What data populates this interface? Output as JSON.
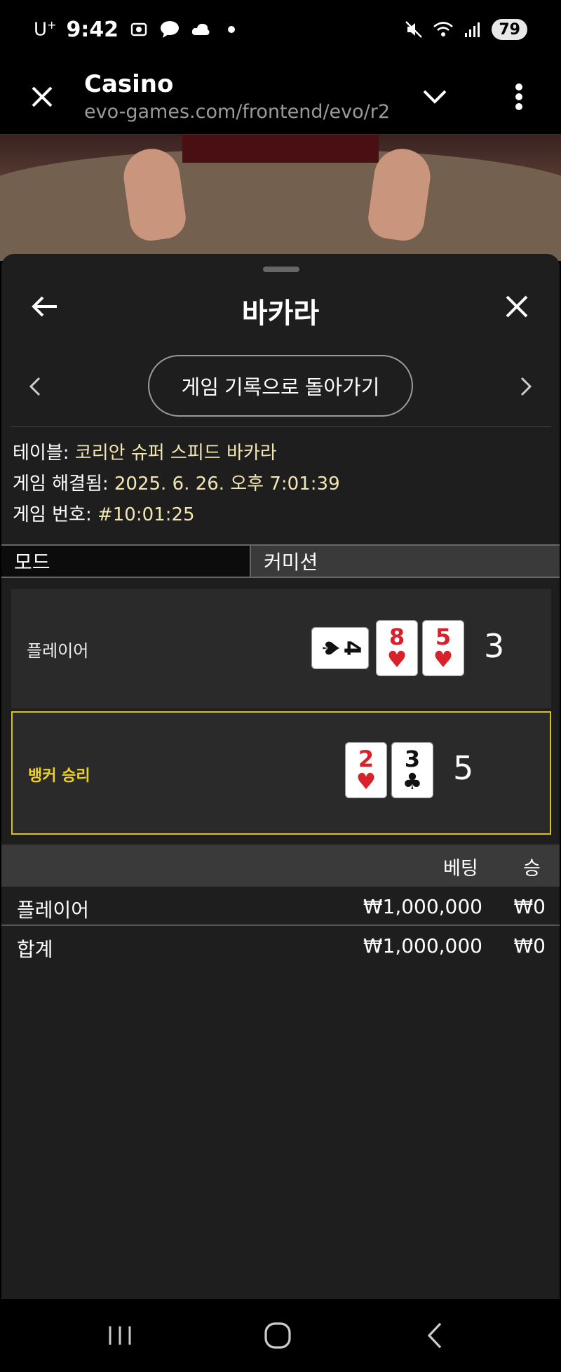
{
  "status_bar": {
    "carrier": "U",
    "carrier_sup": "+",
    "time": "9:42",
    "battery": "79"
  },
  "browser": {
    "title": "Casino",
    "url": "evo-games.com/frontend/evo/r2"
  },
  "panel": {
    "title": "바카라",
    "history_button": "게임 기록으로 돌아가기"
  },
  "info": {
    "table_label": "테이블:",
    "table_value": "코리안 슈퍼 스피드 바카라",
    "resolved_label": "게임 해결됨:",
    "resolved_value": "2025. 6. 26. 오후 7:01:39",
    "number_label": "게임 번호:",
    "number_value": "#10:01:25"
  },
  "tabs": {
    "mode": "모드",
    "commission": "커미션"
  },
  "results": {
    "player": {
      "label": "플레이어",
      "cards": [
        {
          "rank": "4",
          "suit": "♠",
          "color": "black",
          "orientation": "sideways"
        },
        {
          "rank": "8",
          "suit": "♥",
          "color": "red"
        },
        {
          "rank": "5",
          "suit": "♥",
          "color": "red"
        }
      ],
      "score": "3"
    },
    "banker": {
      "label": "뱅커 승리",
      "cards": [
        {
          "rank": "2",
          "suit": "♥",
          "color": "red"
        },
        {
          "rank": "3",
          "suit": "♣",
          "color": "black"
        }
      ],
      "score": "5",
      "highlight_color": "#d9c21b"
    }
  },
  "bets": {
    "header_bet": "베팅",
    "header_win": "승",
    "rows": [
      {
        "name": "플레이어",
        "bet": "₩1,000,000",
        "win": "₩0"
      },
      {
        "name": "합계",
        "bet": "₩1,000,000",
        "win": "₩0"
      }
    ]
  },
  "icons": {
    "close": "close-icon",
    "chevron_down": "chevron-down-icon",
    "more": "more-vertical-icon",
    "back": "arrow-left-icon",
    "prev": "chevron-left-icon",
    "next": "chevron-right-icon"
  }
}
